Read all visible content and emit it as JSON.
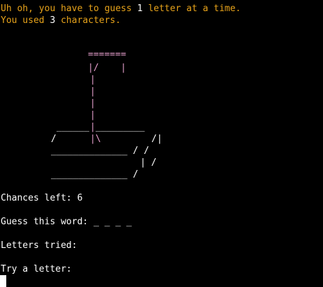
{
  "messages": {
    "line1": {
      "prefix": "Uh oh, you have to guess ",
      "number": "1",
      "suffix": " letter at a time."
    },
    "line2": {
      "prefix": "You used ",
      "number": "3",
      "suffix": " characters."
    }
  },
  "gallows": {
    "top_beam": "=======",
    "row_pole_rope": "|/    |",
    "pole": "|",
    "platform_left": "______",
    "platform_right": "_________",
    "base_line_1_left": "/",
    "base_line_1_mid": "|\\",
    "base_line_1_right": "/|",
    "base_line_2": "______________ / /",
    "base_line_3": "| /",
    "base_line_4": "______________ /"
  },
  "status": {
    "chances_label": "Chances left:",
    "chances_value": "6",
    "guess_word_label": "Guess this word:",
    "guess_word_value": "_ _ _ _",
    "letters_tried_label": "Letters tried:",
    "letters_tried_value": "",
    "prompt_label": "Try a letter:"
  },
  "colors": {
    "background": "#000000",
    "warning": "#e6a21a",
    "gallows": "#e9a1cf",
    "text": "#ffffff"
  }
}
